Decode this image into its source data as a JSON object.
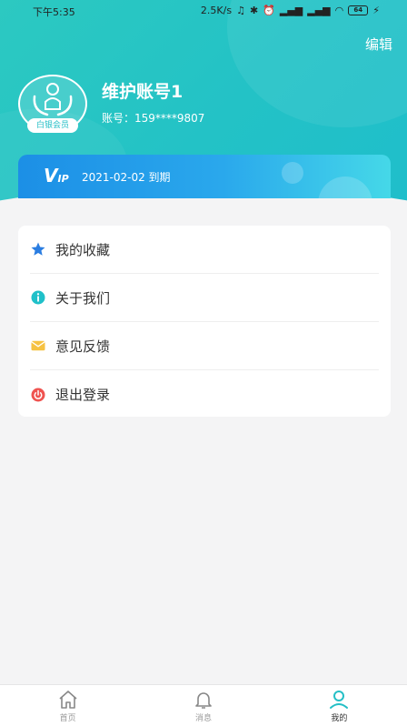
{
  "status_bar": {
    "time": "下午5:35",
    "network_speed": "2.5K/s",
    "battery": "64"
  },
  "header": {
    "edit_label": "编辑",
    "avatar_badge": "白银会员",
    "username": "维护账号1",
    "account_label": "账号：159****9807"
  },
  "vip": {
    "logo_text": "V",
    "logo_sub": "IP",
    "expiry": "2021-02-02 到期"
  },
  "menu": {
    "items": [
      {
        "label": "我的收藏",
        "icon": "star-icon"
      },
      {
        "label": "关于我们",
        "icon": "info-icon"
      },
      {
        "label": "意见反馈",
        "icon": "mail-icon"
      },
      {
        "label": "退出登录",
        "icon": "power-icon"
      }
    ]
  },
  "tabbar": {
    "tabs": [
      {
        "label": "首页",
        "icon": "home-icon"
      },
      {
        "label": "消息",
        "icon": "bell-icon"
      },
      {
        "label": "我的",
        "icon": "person-icon",
        "active": true
      }
    ]
  },
  "colors": {
    "accent": "#24bfc6",
    "vip_start": "#1c8fe6",
    "star": "#2a7de1",
    "info": "#1fc0c9",
    "mail": "#f6c242",
    "power": "#ef5350"
  }
}
